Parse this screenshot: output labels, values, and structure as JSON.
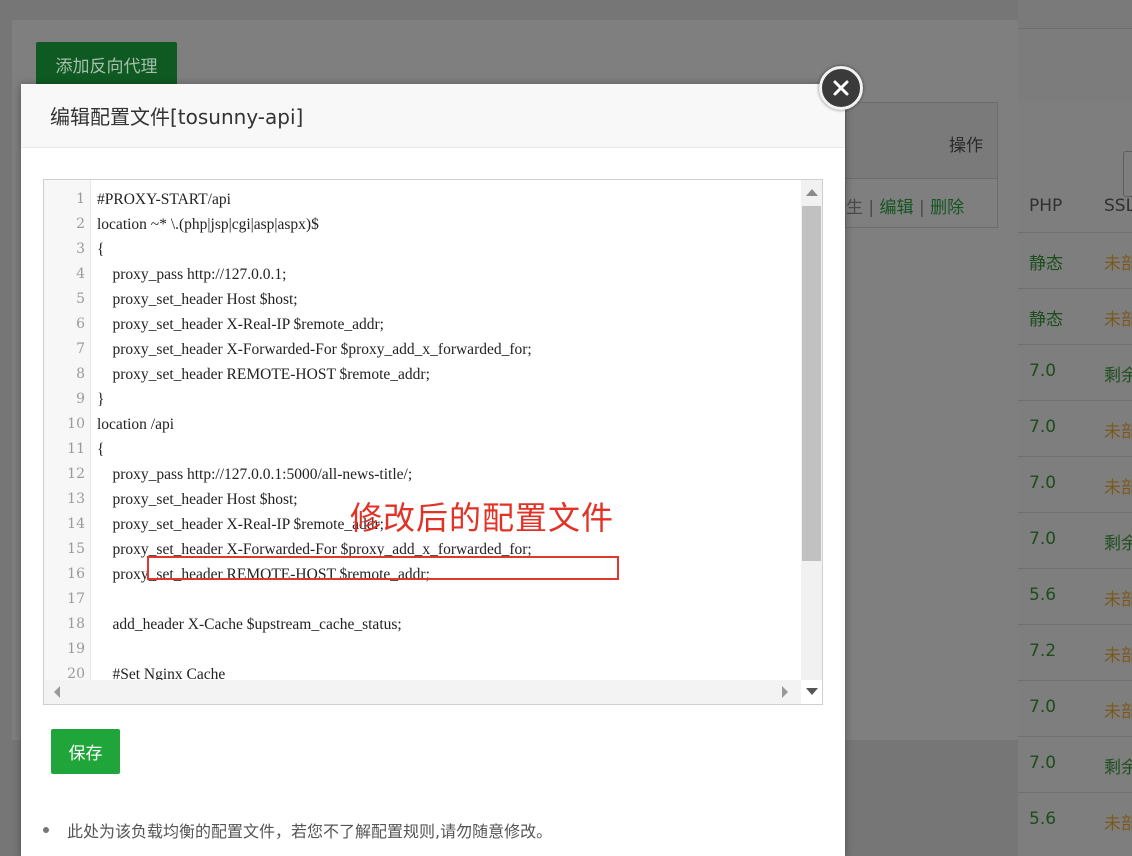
{
  "background": {
    "add_button_label": "添加反向代理",
    "operation_header": "操作",
    "row_actions": {
      "partial": "生",
      "sep": " | ",
      "edit": "编辑",
      "delete": "删除"
    },
    "right_columns": {
      "php": "PHP",
      "ssl": "SSL"
    },
    "right_rows": [
      {
        "php": "静态",
        "ssl": "未部",
        "ssl_color": "#7a5a1c"
      },
      {
        "php": "静态",
        "ssl": "未部",
        "ssl_color": "#7a5a1c"
      },
      {
        "php": "7.0",
        "ssl": "剩余",
        "ssl_color": "#1f4f1f"
      },
      {
        "php": "7.0",
        "ssl": "未部",
        "ssl_color": "#7a5a1c"
      },
      {
        "php": "7.0",
        "ssl": "未部",
        "ssl_color": "#7a5a1c"
      },
      {
        "php": "7.0",
        "ssl": "剩余",
        "ssl_color": "#1f4f1f"
      },
      {
        "php": "5.6",
        "ssl": "未部",
        "ssl_color": "#7a5a1c"
      },
      {
        "php": "7.2",
        "ssl": "未部",
        "ssl_color": "#7a5a1c"
      },
      {
        "php": "7.0",
        "ssl": "未部",
        "ssl_color": "#7a5a1c"
      },
      {
        "php": "7.0",
        "ssl": "剩余",
        "ssl_color": "#1f4f1f"
      },
      {
        "php": "5.6",
        "ssl": "未部",
        "ssl_color": "#7a5a1c"
      }
    ],
    "php_color": "#1c4d1c"
  },
  "dialog": {
    "title": "编辑配置文件[tosunny-api]",
    "close_icon": "close-icon",
    "annotation": "修改后的配置文件",
    "save_label": "保存",
    "tip": "此处为该负载均衡的配置文件，若您不了解配置规则,请勿随意修改。",
    "accent_color": "#20a53a",
    "annotation_color": "#e33125"
  },
  "editor": {
    "lines": [
      {
        "n": "1",
        "text": "#PROXY-START/api"
      },
      {
        "n": "2",
        "text": "location ~* \\.(php|jsp|cgi|asp|aspx)$"
      },
      {
        "n": "3",
        "text": "{"
      },
      {
        "n": "4",
        "text": "    proxy_pass http://127.0.0.1;"
      },
      {
        "n": "5",
        "text": "    proxy_set_header Host $host;"
      },
      {
        "n": "6",
        "text": "    proxy_set_header X-Real-IP $remote_addr;"
      },
      {
        "n": "7",
        "text": "    proxy_set_header X-Forwarded-For $proxy_add_x_forwarded_for;"
      },
      {
        "n": "8",
        "text": "    proxy_set_header REMOTE-HOST $remote_addr;"
      },
      {
        "n": "9",
        "text": "}"
      },
      {
        "n": "10",
        "text": "location /api"
      },
      {
        "n": "11",
        "text": "{"
      },
      {
        "n": "12",
        "text": "    proxy_pass http://127.0.0.1:5000/all-news-title/;"
      },
      {
        "n": "13",
        "text": "    proxy_set_header Host $host;"
      },
      {
        "n": "14",
        "text": "    proxy_set_header X-Real-IP $remote_addr;"
      },
      {
        "n": "15",
        "text": "    proxy_set_header X-Forwarded-For $proxy_add_x_forwarded_for;"
      },
      {
        "n": "16",
        "text": "    proxy_set_header REMOTE-HOST $remote_addr;"
      },
      {
        "n": "17",
        "text": ""
      },
      {
        "n": "18",
        "text": "    add_header X-Cache $upstream_cache_status;"
      },
      {
        "n": "19",
        "text": ""
      },
      {
        "n": "20",
        "text": "    #Set Nginx Cache"
      }
    ]
  }
}
